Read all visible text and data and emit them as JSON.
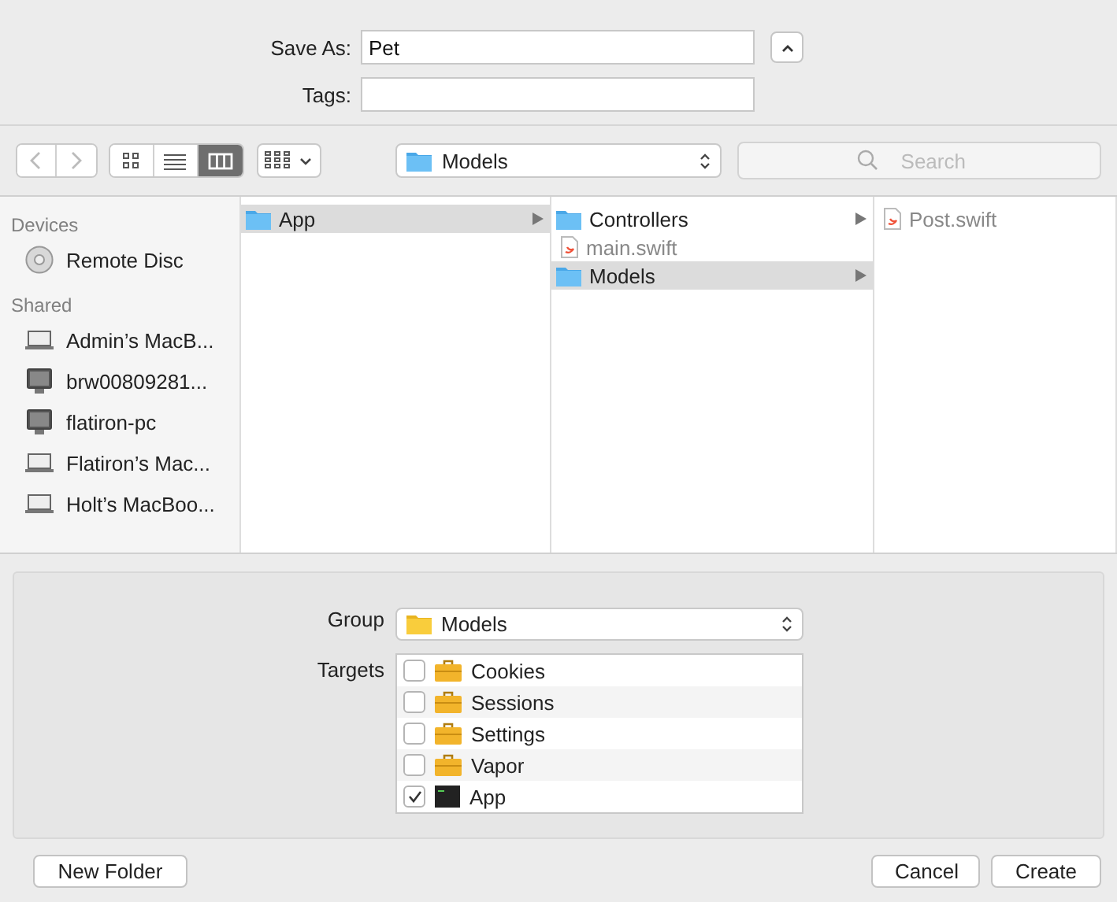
{
  "save_as": {
    "label": "Save As:",
    "value": "Pet"
  },
  "tags": {
    "label": "Tags:"
  },
  "toolbar": {
    "views": [
      {
        "kind": "icons",
        "selected": false
      },
      {
        "kind": "list",
        "selected": false
      },
      {
        "kind": "columns",
        "selected": true
      }
    ],
    "location": "Models",
    "search": {
      "placeholder": "Search"
    }
  },
  "sidebar": [
    {
      "heading": "Devices",
      "items": [
        {
          "kind": "disc",
          "label": "Remote Disc"
        }
      ]
    },
    {
      "heading": "Shared",
      "items": [
        {
          "kind": "laptop",
          "label": "Admin’s MacB..."
        },
        {
          "kind": "monitor",
          "label": "brw00809281..."
        },
        {
          "kind": "monitor",
          "label": "flatiron-pc"
        },
        {
          "kind": "laptop",
          "label": "Flatiron’s Mac..."
        },
        {
          "kind": "laptop",
          "label": "Holt’s MacBoo..."
        }
      ]
    }
  ],
  "columns": [
    [
      {
        "kind": "folder",
        "label": "App",
        "selected": true
      }
    ],
    [
      {
        "kind": "folder",
        "label": "Controllers",
        "selected": false
      },
      {
        "kind": "file",
        "label": "main.swift",
        "selected": false
      },
      {
        "kind": "folder",
        "label": "Models",
        "selected": true
      }
    ],
    [
      {
        "kind": "file",
        "label": "Post.swift",
        "selected": false
      }
    ]
  ],
  "group": {
    "label": "Group",
    "value": "Models"
  },
  "targets": {
    "label": "Targets",
    "items": [
      {
        "kind": "framework",
        "label": "Cookies",
        "checked": false
      },
      {
        "kind": "framework",
        "label": "Sessions",
        "checked": false
      },
      {
        "kind": "framework",
        "label": "Settings",
        "checked": false
      },
      {
        "kind": "framework",
        "label": "Vapor",
        "checked": false
      },
      {
        "kind": "app",
        "label": "App",
        "checked": true
      }
    ]
  },
  "buttons": {
    "new_folder": "New Folder",
    "cancel": "Cancel",
    "create": "Create"
  }
}
